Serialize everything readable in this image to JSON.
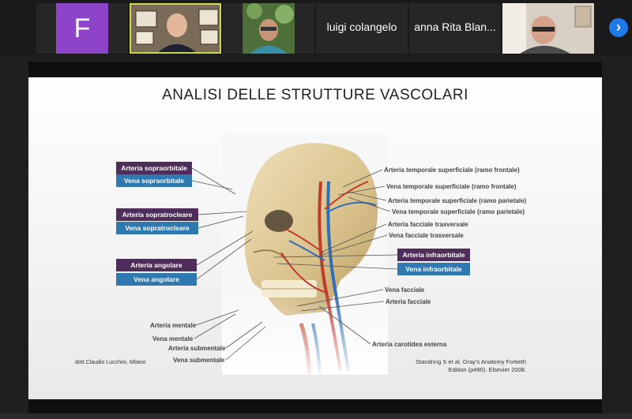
{
  "participants": [
    {
      "type": "initial",
      "letter": "F",
      "name": "F"
    },
    {
      "type": "video",
      "name": "speaker-video"
    },
    {
      "type": "video",
      "name": "participant-video"
    },
    {
      "type": "name",
      "name": "luigi colangelo"
    },
    {
      "type": "name",
      "name": "anna Rita Blan..."
    },
    {
      "type": "video",
      "name": "participant-video-2"
    }
  ],
  "next_icon": "chevron-right-icon",
  "slide": {
    "title": "ANALISI DELLE STRUTTURE VASCOLARI",
    "left_labels": {
      "arteria_sopraorbitale": "Arteria sopraorbitale",
      "vena_sopraorbitale": "Vena sopraorbitale",
      "arteria_sopratrocleare": "Arteria sopratrocleare",
      "vena_sopratrocleare": "Vena sopratrocleare",
      "arteria_angolare": "Arteria angolare",
      "vena_angolare": "Vena angolare",
      "arteria_mentale": "Arteria mentale",
      "vena_mentale": "Vena mentale",
      "arteria_submentale": "Arteria submentale",
      "vena_submentale": "Vena submentale"
    },
    "right_labels": {
      "art_temp_front": "Arteria temporale superficiale (ramo frontale)",
      "vena_temp_front": "Vena temporale superficiale (ramo frontale)",
      "art_temp_par": "Arteria temporale superficiale (ramo parietale)",
      "vena_temp_par": "Vena temporale superficiale (ramo parietale)",
      "art_facc_trasv": "Arteria facciale trasversale",
      "vena_facc_trasv": "Vena facciale trasversale",
      "arteria_infraorbitale": "Arteria infraorbitale",
      "vena_infraorbitale": "Vena infraorbitale",
      "vena_facciale": "Vena facciale",
      "arteria_facciale": "Arteria facciale",
      "art_carotidea": "Arteria carotidea esterna"
    },
    "credit": "dott.Claudio Lucchini, Milano",
    "reference_line1": "Standring S et al. Gray's Anatomy Fortieth",
    "reference_line2": "Edition (p490). Elsevier 2008."
  },
  "colors": {
    "arteria": "#4e2d5a",
    "vena": "#2f78b0",
    "accent": "#1d7ae8",
    "active_border": "#c9d84a"
  }
}
